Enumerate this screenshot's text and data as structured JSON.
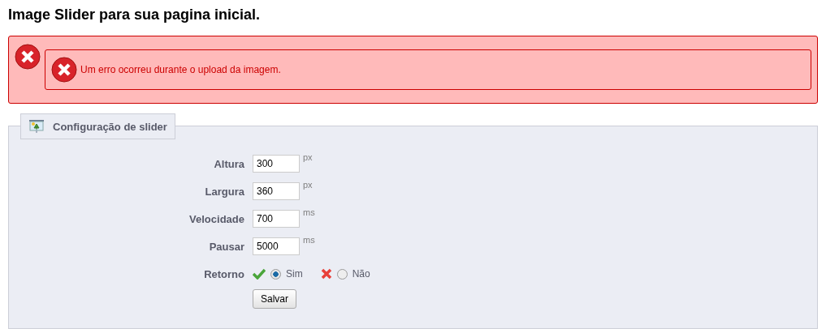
{
  "page_title": "Image Slider para sua pagina inicial.",
  "error": {
    "message": "Um erro ocorreu durante o upload da imagem."
  },
  "panel": {
    "legend": "Configuração de slider",
    "fields": [
      {
        "label": "Altura",
        "value": "300",
        "unit": "px"
      },
      {
        "label": "Largura",
        "value": "360",
        "unit": "px"
      },
      {
        "label": "Velocidade",
        "value": "700",
        "unit": "ms"
      },
      {
        "label": "Pausar",
        "value": "5000",
        "unit": "ms"
      }
    ],
    "toggle": {
      "label": "Retorno",
      "options": [
        {
          "kind": "yes",
          "label": "Sim",
          "selected": true
        },
        {
          "kind": "no",
          "label": "Não",
          "selected": false
        }
      ]
    },
    "submit": "Salvar"
  }
}
